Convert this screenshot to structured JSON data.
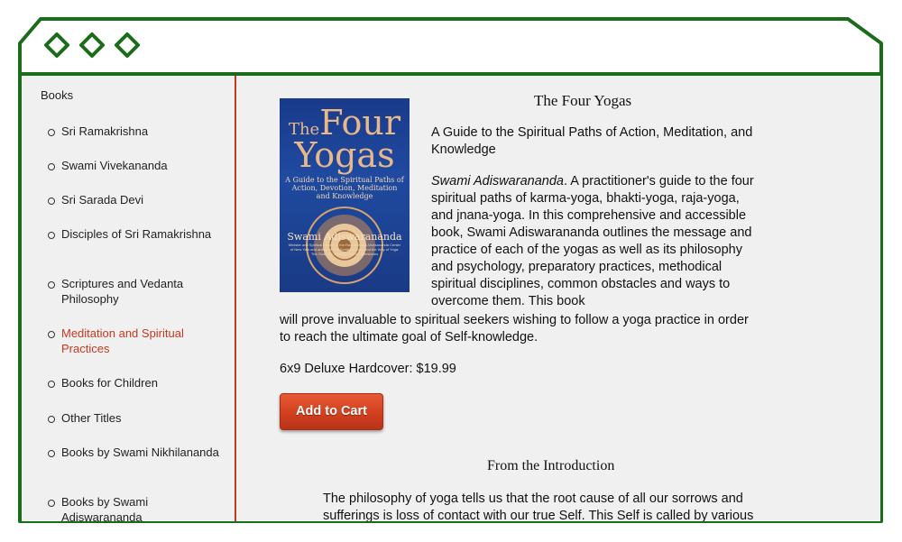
{
  "window": {
    "frame_color": "#1a6b1a",
    "accent_color": "#c8371f",
    "controls": [
      "window-control-icon",
      "window-control-icon",
      "window-control-icon"
    ]
  },
  "sidebar": {
    "title": "Books",
    "items": [
      {
        "label": "Sri Ramakrishna",
        "active": false
      },
      {
        "label": "Swami Vivekananda",
        "active": false
      },
      {
        "label": "Sri Sarada Devi",
        "active": false
      },
      {
        "label": "Disciples of Sri Ramakrishna",
        "active": false
      },
      {
        "label": "Scriptures and Vedanta Philosophy",
        "active": false
      },
      {
        "label": "Meditation and Spiritual Practices",
        "active": true
      },
      {
        "label": "Books for Children",
        "active": false
      },
      {
        "label": "Other Titles",
        "active": false
      },
      {
        "label": "Books by Swami Nikhilananda",
        "active": false
      },
      {
        "label": "Books by Swami Adiswarananda",
        "active": false
      }
    ]
  },
  "product": {
    "title": "The Four Yogas",
    "subtitle": "A Guide to the Spiritual Paths of Action, Meditation, and Knowledge",
    "author": "Swami Adiswarananda",
    "description_part1": ". A practitioner's guide to the four spiritual paths of karma-yoga, bhakti-yoga, raja-yoga, and jnana-yoga. In this comprehensive and accessible book, Swami Adiswarananda outlines the message and practice of each of the yogas as well as its philosophy and psychology, preparatory practices, methodical spiritual disciplines, common obstacles and ways to overcome them. This book",
    "description_part2": "will prove invaluable to spiritual seekers wishing to follow a yoga practice in order to reach the ultimate goal of Self-knowledge.",
    "price": "6x9 Deluxe Hardcover: $19.99",
    "cart_label": "Add to Cart",
    "cover": {
      "title_line1": "The Four",
      "title_the": "The",
      "title_four": "Four",
      "title_line2": "Yogas",
      "subtitle": "A Guide to the Spiritual Paths of Action, Devotion, Meditation and Knowledge",
      "author": "Swami Adiswarananda",
      "fine_print": "Minister and Spiritual Leader of the Ramakrishna-Vivekananda Center of New York and author of The Spiritual Quest and the Way of Yoga: The Goal, the Journey and the Milestones"
    }
  },
  "intro": {
    "heading": "From the Introduction",
    "text": "The philosophy of yoga tells us that the root cause of all our sorrows and sufferings is loss of contact with our true Self. This Self is called by various"
  }
}
